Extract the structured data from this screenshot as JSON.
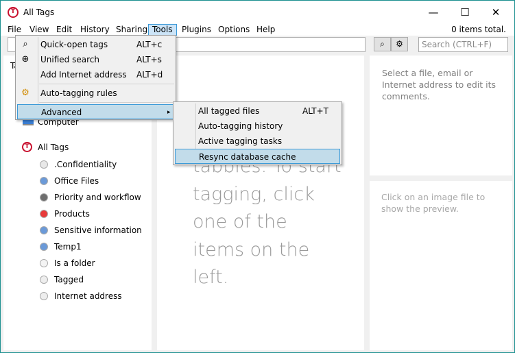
{
  "window": {
    "title": "All Tags",
    "minimize": "—",
    "maximize": "☐",
    "close": "✕"
  },
  "menubar": {
    "items": [
      "File",
      "View",
      "Edit",
      "History",
      "Sharing",
      "Tools",
      "Plugins",
      "Options",
      "Help"
    ],
    "active": "Tools",
    "status": "0 items total."
  },
  "toolbar": {
    "search_placeholder": "Search (CTRL+F)",
    "quick_open_icon": "magnifier-tag-icon",
    "autotag_icon": "gear-icon"
  },
  "left_panel": {
    "header": "Ta",
    "computer": "Computer",
    "root": "All Tags",
    "tags": [
      {
        "label": ".Confidentiality",
        "color": "#e8e8e8"
      },
      {
        "label": "Office Files",
        "color": "#6b9ad8"
      },
      {
        "label": "Priority and workflow",
        "color": "#6e6e6e"
      },
      {
        "label": "Products",
        "color": "#e83a3a"
      },
      {
        "label": "Sensitive information",
        "color": "#6b9ad8"
      },
      {
        "label": "Temp1",
        "color": "#6b9ad8"
      },
      {
        "label": "Is a folder",
        "color": "#f4f4f4"
      },
      {
        "label": "Tagged",
        "color": "#eeeeee"
      },
      {
        "label": "Internet address",
        "color": "#eeeeee"
      }
    ]
  },
  "center": {
    "lines": [
      "tabbies. To start",
      "tagging, click",
      "one of the",
      "items on the",
      "left."
    ]
  },
  "right": {
    "comments_hint": "Select a file, email or Internet address to edit its comments.",
    "preview_hint": "Click on an image file to show the preview."
  },
  "tools_menu": {
    "items": [
      {
        "label": "Quick-open tags",
        "shortcut": "ALT+c"
      },
      {
        "label": "Unified search",
        "shortcut": "ALT+s"
      },
      {
        "label": "Add Internet address",
        "shortcut": "ALT+d"
      },
      {
        "label": "Auto-tagging rules",
        "shortcut": ""
      },
      {
        "label": "Advanced",
        "shortcut": "▸"
      }
    ]
  },
  "advanced_menu": {
    "items": [
      {
        "label": "All tagged files",
        "shortcut": "ALT+T"
      },
      {
        "label": "Auto-tagging history",
        "shortcut": ""
      },
      {
        "label": "Active tagging tasks",
        "shortcut": ""
      },
      {
        "label": "Resync database cache",
        "shortcut": ""
      }
    ],
    "highlighted": "Resync database cache"
  }
}
